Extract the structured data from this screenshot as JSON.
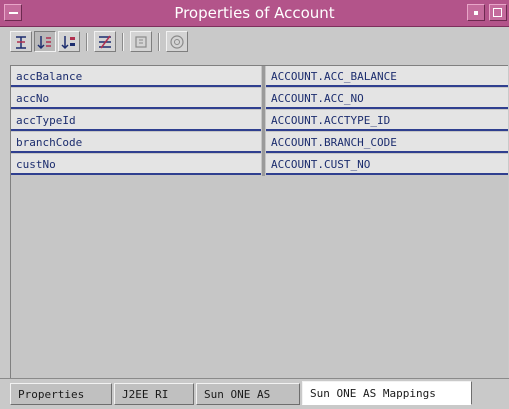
{
  "window": {
    "title": "Properties of Account",
    "accent_color": "#b3548a"
  },
  "toolbar": {
    "buttons": [
      {
        "icon": "unsorted-icon",
        "pressed": false
      },
      {
        "icon": "sort-by-name-icon",
        "pressed": true
      },
      {
        "icon": "sort-by-type-icon",
        "pressed": false
      },
      {
        "icon": "show-editable-only-icon",
        "pressed": false
      },
      {
        "icon": "property-sheet-icon",
        "pressed": false
      },
      {
        "icon": "help-icon",
        "pressed": false
      }
    ]
  },
  "properties": [
    {
      "name": "accBalance",
      "value": "ACCOUNT.ACC_BALANCE"
    },
    {
      "name": "accNo",
      "value": "ACCOUNT.ACC_NO"
    },
    {
      "name": "accTypeId",
      "value": "ACCOUNT.ACCTYPE_ID"
    },
    {
      "name": "branchCode",
      "value": "ACCOUNT.BRANCH_CODE"
    },
    {
      "name": "custNo",
      "value": "ACCOUNT.CUST_NO"
    }
  ],
  "tabs": [
    {
      "label": "Properties",
      "active": false
    },
    {
      "label": "J2EE RI",
      "active": false
    },
    {
      "label": "Sun ONE AS",
      "active": false
    },
    {
      "label": "Sun ONE AS Mappings",
      "active": true
    }
  ]
}
